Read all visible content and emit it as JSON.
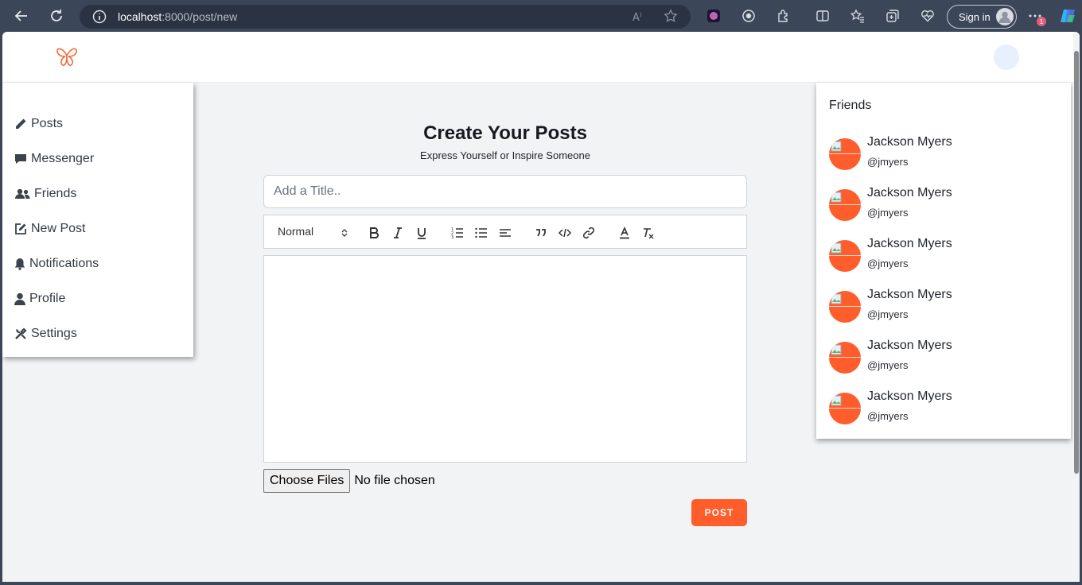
{
  "browser": {
    "url_host": "localhost",
    "url_path": ":8000/post/new",
    "signin_label": "Sign in",
    "notification_count": "1"
  },
  "sidebar": {
    "items": [
      {
        "label": "Posts",
        "icon": "pencil-icon"
      },
      {
        "label": "Messenger",
        "icon": "chat-icon"
      },
      {
        "label": "Friends",
        "icon": "users-icon"
      },
      {
        "label": "New Post",
        "icon": "edit-icon"
      },
      {
        "label": "Notifications",
        "icon": "bell-icon"
      },
      {
        "label": "Profile",
        "icon": "user-icon"
      },
      {
        "label": "Settings",
        "icon": "tools-icon"
      }
    ]
  },
  "main": {
    "title": "Create Your Posts",
    "subtitle": "Express Yourself or Inspire Someone",
    "title_placeholder": "Add a Title..",
    "heading_select": "Normal",
    "file_button": "Choose Files",
    "file_status": "No file chosen",
    "post_button": "POST"
  },
  "friends": {
    "heading": "Friends",
    "list": [
      {
        "name": "Jackson Myers",
        "username": "@jmyers"
      },
      {
        "name": "Jackson Myers",
        "username": "@jmyers"
      },
      {
        "name": "Jackson Myers",
        "username": "@jmyers"
      },
      {
        "name": "Jackson Myers",
        "username": "@jmyers"
      },
      {
        "name": "Jackson Myers",
        "username": "@jmyers"
      },
      {
        "name": "Jackson Myers",
        "username": "@jmyers"
      }
    ]
  },
  "colors": {
    "accent": "#ff5d2b",
    "chrome": "#3b4658",
    "page_bg": "#f2f3f5"
  }
}
